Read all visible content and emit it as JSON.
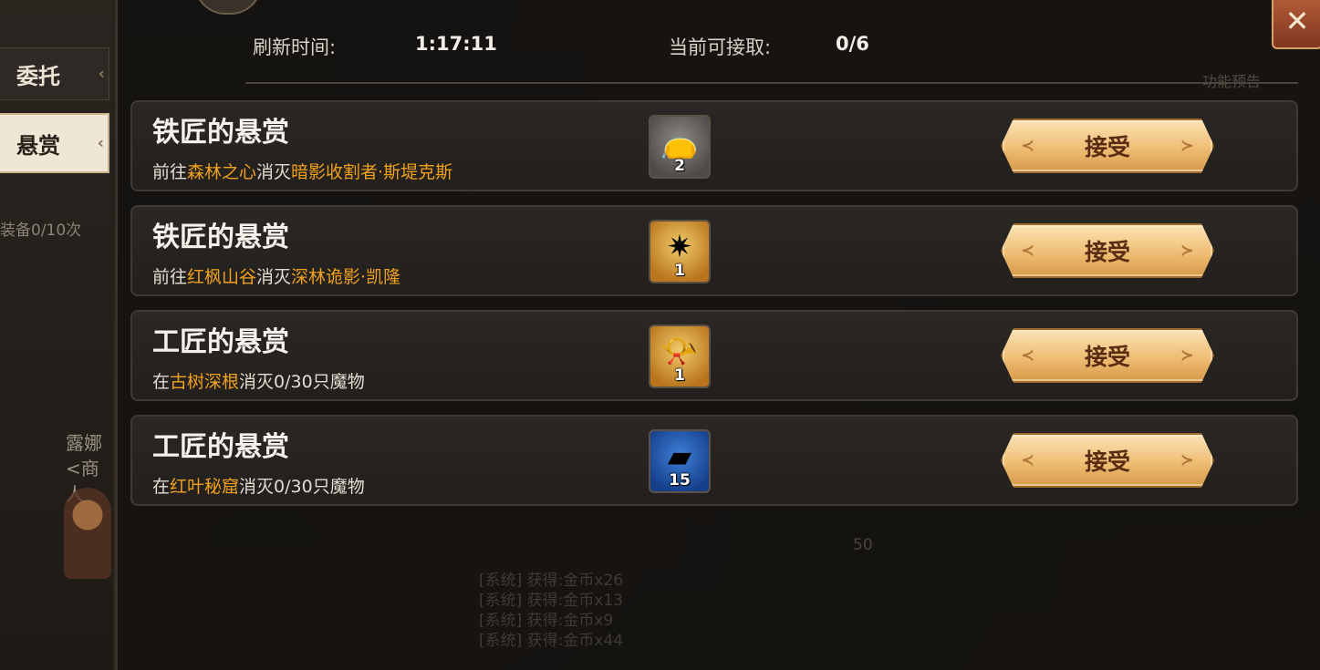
{
  "sidebar": {
    "tabs": [
      {
        "label": "委托",
        "active": false
      },
      {
        "label": "悬赏",
        "active": true
      }
    ],
    "note": "装备0/10次",
    "npc": {
      "name": "露娜",
      "role": "<商人"
    }
  },
  "header": {
    "refresh_label": "刷新时间:",
    "refresh_value": "1:17:11",
    "accept_label": "当前可接取:",
    "accept_value": "0/6"
  },
  "close_icon": "close-icon",
  "ghost_label": "功能预告",
  "quests": [
    {
      "title": "铁匠的悬赏",
      "desc": [
        "前往",
        "森林之心",
        "消灭",
        "暗影收割者·斯堤克斯"
      ],
      "reward": {
        "icon": "pouch-icon",
        "count": "2",
        "color": "gray"
      },
      "button": "接受"
    },
    {
      "title": "铁匠的悬赏",
      "desc": [
        "前往",
        "红枫山谷",
        "消灭",
        "深林诡影·凯隆"
      ],
      "reward": {
        "icon": "crystal-icon",
        "count": "1",
        "color": "gold"
      },
      "button": "接受"
    },
    {
      "title": "工匠的悬赏",
      "desc": [
        "在",
        "古树深根",
        "消灭0/30只魔物",
        ""
      ],
      "reward": {
        "icon": "horn-icon",
        "count": "1",
        "color": "gold"
      },
      "button": "接受"
    },
    {
      "title": "工匠的悬赏",
      "desc": [
        "在",
        "红叶秘窟",
        "消灭0/30只魔物",
        ""
      ],
      "reward": {
        "icon": "ingot-icon",
        "count": "15",
        "color": "blue"
      },
      "button": "接受"
    }
  ],
  "background_chat": [
    "[系统] 获得:金币x26",
    "[系统] 获得:金币x13",
    "[系统] 获得:金币x9",
    "[系统] 获得:金币x44"
  ],
  "background_badge": "50",
  "colors": {
    "highlight": "#f0a11e",
    "button_text": "#5a2c12"
  }
}
